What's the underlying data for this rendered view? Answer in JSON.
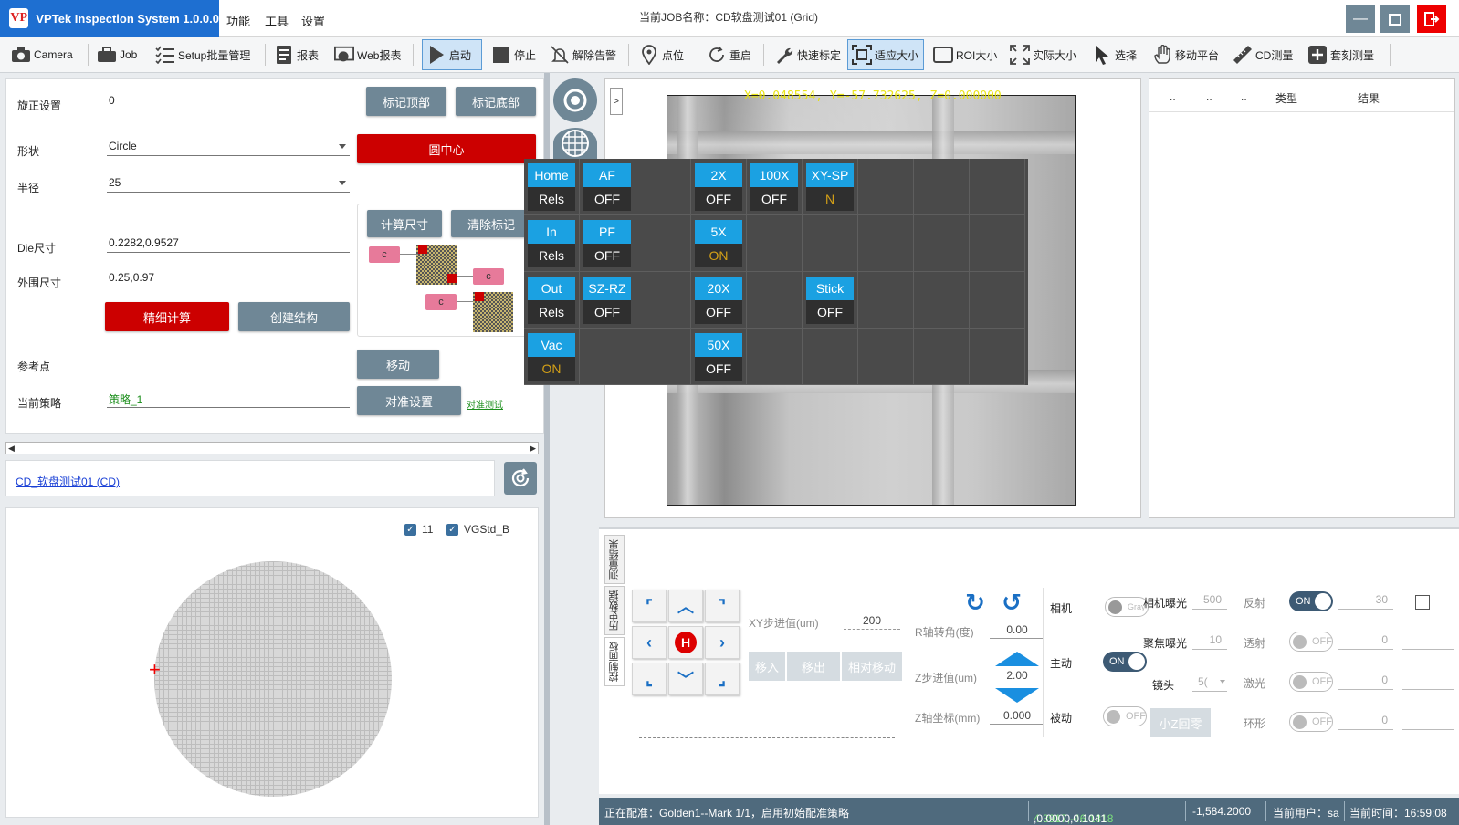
{
  "app": {
    "logo_text": "VP",
    "name": "VPTek Inspection System 1.0.0.0",
    "menu": [
      "功能",
      "工具",
      "设置"
    ],
    "job_title": "当前JOB名称：CD软盘测试01 (Grid)"
  },
  "toolbar": {
    "items": [
      {
        "label": "Camera",
        "icon": "camera-icon"
      },
      {
        "label": "Job",
        "icon": "briefcase-icon"
      },
      {
        "label": "Setup批量管理",
        "icon": "checklist-icon"
      },
      {
        "label": "报表",
        "icon": "report-icon"
      },
      {
        "label": "Web报表",
        "icon": "web-report-icon"
      },
      {
        "label": "启动",
        "icon": "play-icon",
        "active": true
      },
      {
        "label": "停止",
        "icon": "stop-icon"
      },
      {
        "label": "解除告警",
        "icon": "bell-off-icon"
      },
      {
        "label": "点位",
        "icon": "location-pin-icon"
      },
      {
        "label": "重启",
        "icon": "restart-icon"
      },
      {
        "label": "快速标定",
        "icon": "wrench-icon"
      },
      {
        "label": "适应大小",
        "icon": "fit-size-icon",
        "active": true
      },
      {
        "label": "ROI大小",
        "icon": "roi-icon"
      },
      {
        "label": "实际大小",
        "icon": "actual-size-icon"
      },
      {
        "label": "选择",
        "icon": "cursor-icon"
      },
      {
        "label": "移动平台",
        "icon": "hand-icon"
      },
      {
        "label": "CD测量",
        "icon": "ruler-icon"
      },
      {
        "label": "套刻测量",
        "icon": "plus-box-icon"
      }
    ]
  },
  "setup": {
    "rotation_label": "旋正设置",
    "rotation_value": "0",
    "mark_top": "标记顶部",
    "mark_bottom": "标记底部",
    "shape_label": "形状",
    "shape_value": "Circle",
    "circle_center": "圆中心",
    "radius_label": "半径",
    "radius_value": "25",
    "calc_size": "计算尺寸",
    "clear_mark": "清除标记",
    "die_label": "Die尺寸",
    "die_value": "0.2282,0.9527",
    "outer_label": "外围尺寸",
    "outer_value": "0.25,0.97",
    "fine_calc": "精细计算",
    "create_struct": "创建结构",
    "ref_label": "参考点",
    "ref_value": "",
    "move": "移动",
    "strategy_label": "当前策略",
    "strategy_value": "策略_1",
    "align_setting": "对准设置",
    "align_test": "对准测试",
    "struct_c": "c"
  },
  "cd_link": "CD_软盘测试01 (CD)",
  "wafer": {
    "check1": "11",
    "check2": "VGStd_B",
    "check_mark": "✓"
  },
  "camera": {
    "coords": "X=0.048554, Y=-57.732625, Z=0.000000",
    "expander": ">"
  },
  "control_grid": {
    "tiles": [
      {
        "col": 0,
        "row": 0,
        "top": "Home",
        "bottom": "Rels",
        "on": false
      },
      {
        "col": 1,
        "row": 0,
        "top": "AF",
        "bottom": "OFF",
        "on": false
      },
      {
        "col": 3,
        "row": 0,
        "top": "2X",
        "bottom": "OFF",
        "on": false
      },
      {
        "col": 4,
        "row": 0,
        "top": "100X",
        "bottom": "OFF",
        "on": false
      },
      {
        "col": 5,
        "row": 0,
        "top": "XY-SP",
        "bottom": "N",
        "on": true
      },
      {
        "col": 0,
        "row": 1,
        "top": "In",
        "bottom": "Rels",
        "on": false
      },
      {
        "col": 1,
        "row": 1,
        "top": "PF",
        "bottom": "OFF",
        "on": false
      },
      {
        "col": 3,
        "row": 1,
        "top": "5X",
        "bottom": "ON",
        "on": true
      },
      {
        "col": 0,
        "row": 2,
        "top": "Out",
        "bottom": "Rels",
        "on": false
      },
      {
        "col": 1,
        "row": 2,
        "top": "SZ-RZ",
        "bottom": "OFF",
        "on": false
      },
      {
        "col": 3,
        "row": 2,
        "top": "20X",
        "bottom": "OFF",
        "on": false
      },
      {
        "col": 5,
        "row": 2,
        "top": "Stick",
        "bottom": "OFF",
        "on": false
      },
      {
        "col": 0,
        "row": 3,
        "top": "Vac",
        "bottom": "ON",
        "on": true
      },
      {
        "col": 3,
        "row": 3,
        "top": "50X",
        "bottom": "OFF",
        "on": false
      }
    ]
  },
  "results": {
    "headers": [
      "..",
      "..",
      "..",
      "类型",
      "结果"
    ]
  },
  "tabs": [
    "测量结果",
    "历史数据",
    "控制面板"
  ],
  "control": {
    "home_key": "H",
    "xy_step_label": "XY步进值(um)",
    "xy_step_value": "200",
    "move_in": "移入",
    "move_out": "移出",
    "rel_move": "相对移动",
    "r_angle_label": "R轴转角(度)",
    "r_angle_value": "0.00",
    "z_step_label": "Z步进值(um)",
    "z_step_value": "2.00",
    "z_coord_label": "Z轴坐标(mm)",
    "z_coord_value": "0.000",
    "camera_label": "相机",
    "active_label": "主动",
    "passive_label": "被动",
    "camera_toggle": "Gray",
    "active_toggle": "ON",
    "passive_toggle": "OFF",
    "small_z_home": "小Z回零",
    "cam_exposure_label": "相机曝光",
    "cam_exposure_value": "500",
    "focus_exposure_label": "聚焦曝光",
    "focus_exposure_value": "10",
    "lens_label": "镜头",
    "lens_value": "5(",
    "reflect_label": "反射",
    "reflect_toggle": "ON",
    "reflect_value": "30",
    "transmit_label": "透射",
    "transmit_toggle": "OFF",
    "transmit_value": "0",
    "laser_label": "激光",
    "laser_toggle": "OFF",
    "laser_value": "0",
    "ring_label": "环形",
    "ring_toggle": "OFF",
    "ring_value": "0"
  },
  "status": {
    "message": "正在配准：Golden1--Mark 1/1，启用初始配准策略",
    "pos_green": "4.3917,-46.1318",
    "pos_white": ",0.0000,0.1041",
    "value2": "-1,584.2000",
    "user": "当前用户：sa",
    "time": "当前时间：16:59:08"
  },
  "colors": {
    "accent_blue": "#1e6fd1",
    "tile_blue": "#1ba1e2",
    "button_grey": "#6f8796",
    "button_red": "#cc0000",
    "status_bar": "#4f6a7d",
    "tile_on_text": "#d4a017"
  }
}
